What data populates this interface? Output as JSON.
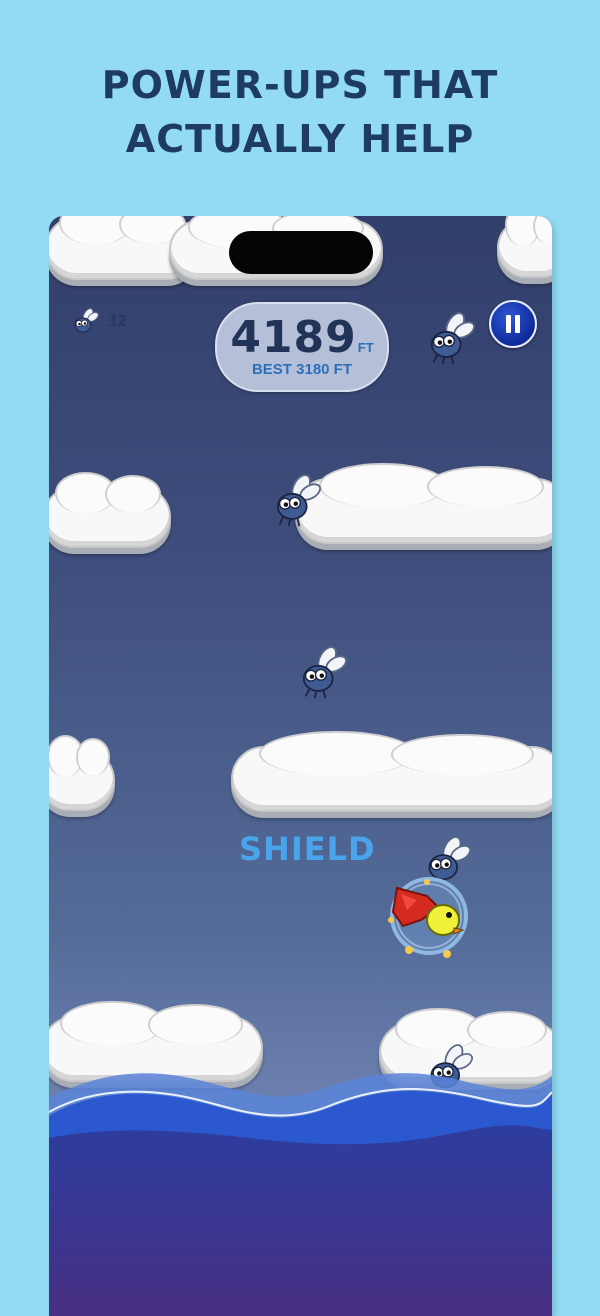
{
  "headline": {
    "line1": "POWER-UPS THAT",
    "line2": "ACTUALLY HELP"
  },
  "hud": {
    "fly_count": "12",
    "score": "4189",
    "score_unit": "FT",
    "best": "BEST 3180 FT"
  },
  "powerup": {
    "label": "SHIELD"
  },
  "icons": {
    "pause": "pause-icon",
    "fly": "fly-icon",
    "player": "caped-bird-player"
  },
  "colors": {
    "background": "#93dbf3",
    "headline": "#1e3b63",
    "sky_top": "#323f6b",
    "sky_bottom": "#8588b8",
    "accent_blue": "#2b6fba",
    "shield_text": "#49a4ec",
    "pause_button": "#0d2a9a",
    "water": "#2a3a96"
  }
}
